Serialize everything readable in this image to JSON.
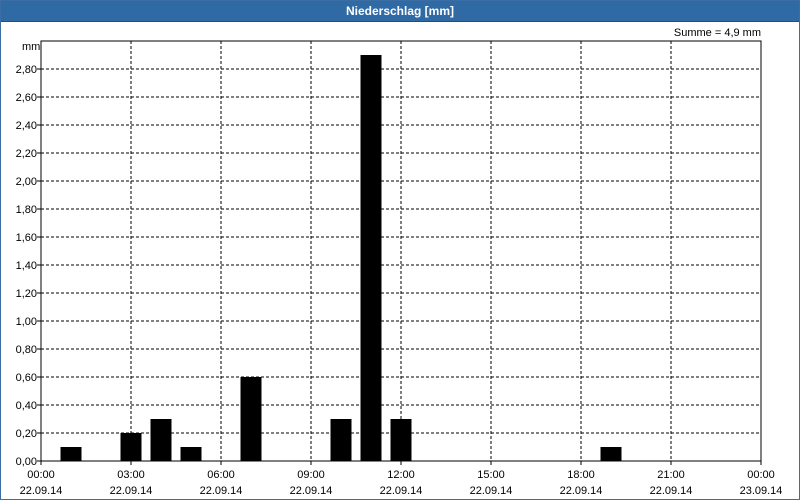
{
  "window": {
    "title": "Niederschlag [mm]"
  },
  "summary": {
    "text": "Summe = 4,9 mm"
  },
  "chart_data": {
    "type": "bar",
    "title": "Niederschlag [mm]",
    "ylabel": "mm",
    "ylim": [
      0,
      3.0
    ],
    "y_ticks": [
      "0,00",
      "0,20",
      "0,40",
      "0,60",
      "0,80",
      "1,00",
      "1,20",
      "1,40",
      "1,60",
      "1,80",
      "2,00",
      "2,20",
      "2,40",
      "2,60",
      "2,80"
    ],
    "x_range_hours": [
      0,
      24
    ],
    "x_ticks": [
      {
        "time": "00:00",
        "date": "22.09.14"
      },
      {
        "time": "03:00",
        "date": "22.09.14"
      },
      {
        "time": "06:00",
        "date": "22.09.14"
      },
      {
        "time": "09:00",
        "date": "22.09.14"
      },
      {
        "time": "12:00",
        "date": "22.09.14"
      },
      {
        "time": "15:00",
        "date": "22.09.14"
      },
      {
        "time": "18:00",
        "date": "22.09.14"
      },
      {
        "time": "21:00",
        "date": "22.09.14"
      },
      {
        "time": "00:00",
        "date": "23.09.14"
      }
    ],
    "bars": [
      {
        "hour": 1,
        "value": 0.1
      },
      {
        "hour": 3,
        "value": 0.2
      },
      {
        "hour": 4,
        "value": 0.3
      },
      {
        "hour": 5,
        "value": 0.1
      },
      {
        "hour": 7,
        "value": 0.6
      },
      {
        "hour": 10,
        "value": 0.3
      },
      {
        "hour": 11,
        "value": 2.9
      },
      {
        "hour": 12,
        "value": 0.3
      },
      {
        "hour": 19,
        "value": 0.1
      }
    ],
    "grid": true,
    "colors": {
      "bar": "#000000",
      "titlebar": "#2f6aa5"
    }
  }
}
